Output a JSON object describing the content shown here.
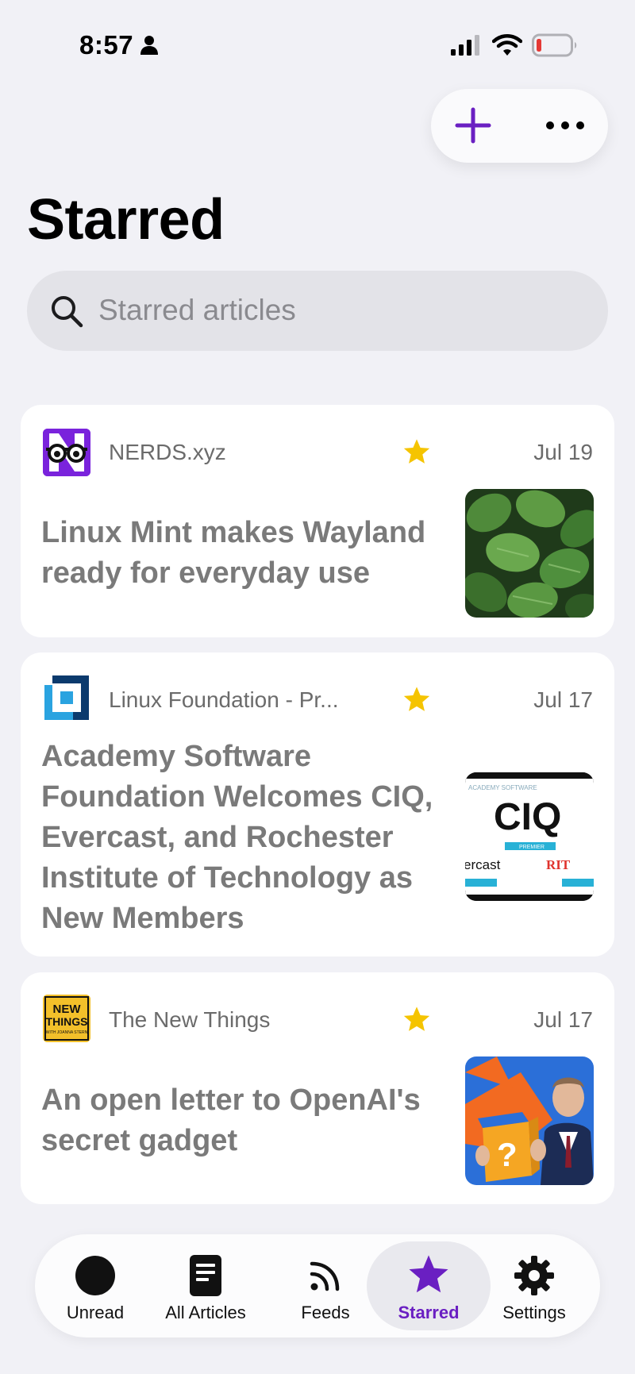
{
  "status_bar": {
    "time": "8:57"
  },
  "page": {
    "title": "Starred"
  },
  "search": {
    "placeholder": "Starred articles"
  },
  "articles": [
    {
      "feed": "NERDS.xyz",
      "date": "Jul 19",
      "title": "Linux Mint makes Wayland ready for everyday use",
      "thumbnail": "mint-leaves",
      "starred": true
    },
    {
      "feed": "Linux Foundation - Pr...",
      "date": "Jul 17",
      "title": "Academy Software Foundation Welcomes CIQ, Evercast, and Rochester Institute of Technology as New Members",
      "thumbnail": "ciq-logos",
      "thumb_text": {
        "ciq": "CIQ",
        "premier": "PREMIER",
        "evercast": "ercast",
        "rit": "RIT"
      },
      "starred": true
    },
    {
      "feed": "The New Things",
      "date": "Jul 17",
      "title": "An open letter to OpenAI's secret gadget",
      "thumbnail": "man-with-mystery-box",
      "feed_logo_text": {
        "line1": "NEW",
        "line2": "THINGS",
        "line3": "WITH JOANNA STERN"
      },
      "starred": true
    }
  ],
  "tabs": [
    {
      "label": "Unread",
      "icon": "filled-circle-icon",
      "active": false
    },
    {
      "label": "All Articles",
      "icon": "document-icon",
      "active": false
    },
    {
      "label": "Feeds",
      "icon": "rss-icon",
      "active": false
    },
    {
      "label": "Starred",
      "icon": "star-icon",
      "active": true
    },
    {
      "label": "Settings",
      "icon": "gear-icon",
      "active": false
    }
  ],
  "colors": {
    "accent": "#6a1fc2",
    "star": "#f5c400",
    "background": "#f1f1f6",
    "card": "#ffffff"
  }
}
